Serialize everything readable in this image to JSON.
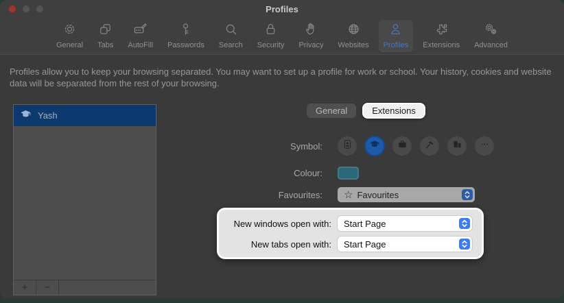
{
  "window": {
    "title": "Profiles"
  },
  "toolbar": {
    "items": [
      {
        "label": "General",
        "icon": "gear-icon"
      },
      {
        "label": "Tabs",
        "icon": "tabs-icon"
      },
      {
        "label": "AutoFill",
        "icon": "autofill-icon"
      },
      {
        "label": "Passwords",
        "icon": "key-icon"
      },
      {
        "label": "Search",
        "icon": "magnifier-icon"
      },
      {
        "label": "Security",
        "icon": "lock-icon"
      },
      {
        "label": "Privacy",
        "icon": "hand-icon"
      },
      {
        "label": "Websites",
        "icon": "globe-icon"
      },
      {
        "label": "Profiles",
        "icon": "person-icon",
        "selected": true
      },
      {
        "label": "Extensions",
        "icon": "puzzle-icon"
      },
      {
        "label": "Advanced",
        "icon": "gears-icon"
      }
    ]
  },
  "description": "Profiles allow you to keep your browsing separated. You may want to set up a profile for work or school. Your history, cookies and website data will be separated from the rest of your browsing.",
  "sidebar": {
    "profiles": [
      {
        "name": "Yash",
        "icon": "graduation-cap-icon",
        "selected": true
      }
    ],
    "add_button": "+",
    "remove_button": "−"
  },
  "panel": {
    "tabs": [
      {
        "label": "General"
      },
      {
        "label": "Extensions",
        "highlighted": true
      }
    ],
    "symbol_label": "Symbol:",
    "symbols": [
      "person-badge",
      "graduation-cap",
      "briefcase",
      "hammer",
      "building",
      "more"
    ],
    "selected_symbol": "graduation-cap",
    "colour_label": "Colour:",
    "colour_value": "#2b6878",
    "favourites_label": "Favourites:",
    "favourites_value": "Favourites",
    "favourites_star": "☆",
    "new_windows_label": "New windows open with:",
    "new_windows_value": "Start Page",
    "new_tabs_label": "New tabs open with:",
    "new_tabs_value": "Start Page"
  },
  "colors": {
    "accent_blue": "#3b7df5",
    "selected_row_blue": "#0d3a6e",
    "highlight_border": "#ffffff",
    "dim_overlay_gray": "#3a3a3a"
  }
}
